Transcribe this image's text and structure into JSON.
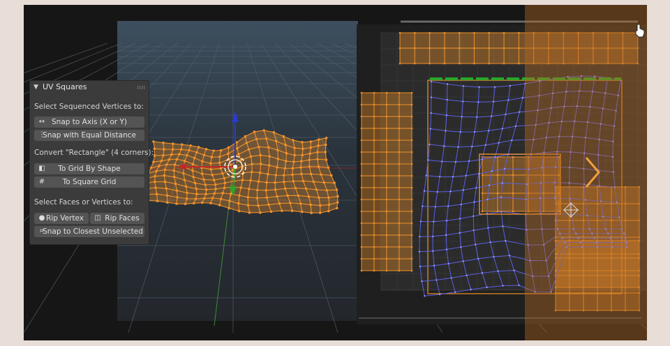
{
  "panel": {
    "title": "UV Squares",
    "sections": {
      "sequenced": "Select Sequenced Vertices to:",
      "rectangle": "Convert \"Rectangle\" (4 corners):",
      "faces": "Select Faces or Vertices to:"
    },
    "buttons": {
      "snap_axis": "Snap to Axis (X or Y)",
      "snap_equal": "Snap with Equal Distance",
      "grid_by_shape": "To Grid By Shape",
      "square_grid": "To Square Grid",
      "rip_vertex": "Rip Vertex",
      "rip_faces": "Rip Faces",
      "snap_closest": "Snap to Closest Unselected"
    }
  },
  "icons": {
    "collapse": "chevron-down-icon",
    "axis": "horizontal-arrows-icon",
    "equal": "vertical-dots-icon",
    "grid_shape": "grid-shape-icon",
    "square_grid": "hash-icon",
    "rip_vertex": "dot-icon",
    "rip_faces": "rip-faces-icon",
    "snap_closest": "snap-icon",
    "next": "chevron-right-icon",
    "cursor": "hand-pointer-icon"
  },
  "colors": {
    "mesh_orange": "#f0922a",
    "uv_blue": "#5a5fe8",
    "selected_edge_green": "#2aa62a",
    "panel_bg": "#3b3b3b",
    "button_bg": "#545454"
  }
}
